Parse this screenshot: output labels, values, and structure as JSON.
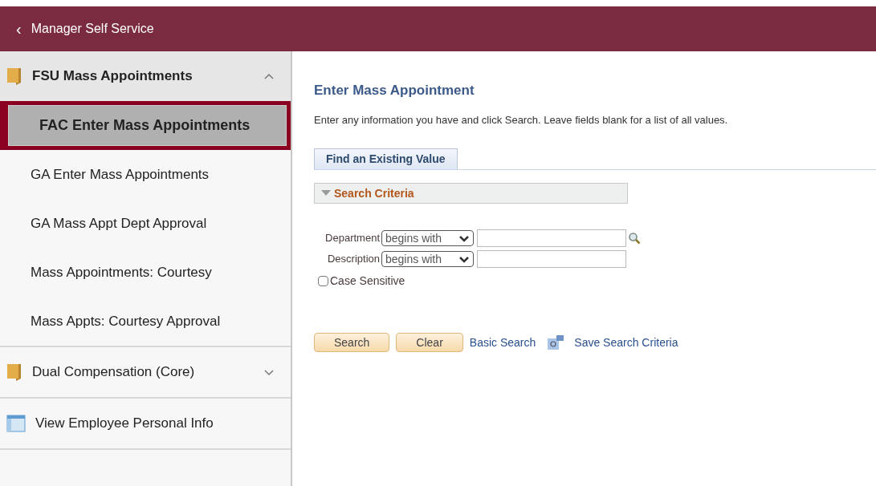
{
  "header": {
    "back": "‹",
    "title": "Manager Self Service"
  },
  "sidebar": {
    "items": [
      {
        "kind": "folder",
        "label": "FSU Mass Appointments",
        "expanded": true,
        "children": [
          {
            "label": "FAC Enter Mass Appointments",
            "selected": true
          },
          {
            "label": "GA Enter Mass Appointments",
            "selected": false
          },
          {
            "label": "GA Mass Appt Dept Approval",
            "selected": false
          },
          {
            "label": "Mass Appointments: Courtesy",
            "selected": false
          },
          {
            "label": "Mass Appts: Courtesy Approval",
            "selected": false
          }
        ]
      },
      {
        "kind": "folder",
        "label": "Dual Compensation (Core)",
        "expanded": false
      },
      {
        "kind": "page",
        "label": "View Employee Personal Info"
      }
    ]
  },
  "content": {
    "title": "Enter Mass Appointment",
    "instructions": "Enter any information you have and click Search. Leave fields blank for a list of all values.",
    "tab": "Find an Existing Value",
    "section": "Search Criteria",
    "fields": [
      {
        "label": "Department",
        "operator": "begins with",
        "lookup": true
      },
      {
        "label": "Description",
        "operator": "begins with",
        "lookup": false
      }
    ],
    "case_sensitive": {
      "label": "Case Sensitive",
      "checked": false
    },
    "buttons": [
      "Search",
      "Clear"
    ],
    "basic_search": "Basic Search",
    "save_search": "Save Search Criteria"
  }
}
